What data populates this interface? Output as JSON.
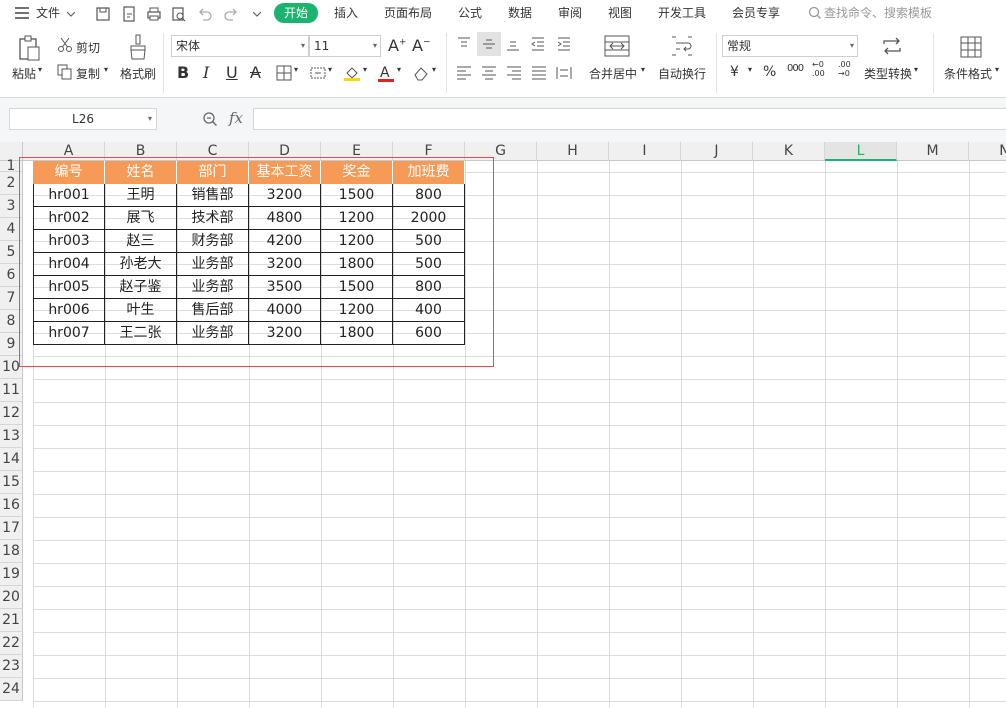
{
  "menubar": {
    "file": "文件",
    "tabs": [
      "开始",
      "插入",
      "页面布局",
      "公式",
      "数据",
      "审阅",
      "视图",
      "开发工具",
      "会员专享"
    ],
    "search_placeholder": "查找命令、搜索模板"
  },
  "ribbon": {
    "paste": "粘贴",
    "cut": "剪切",
    "copy": "复制",
    "format_painter": "格式刷",
    "font_name": "宋体",
    "font_size": "11",
    "merge_center": "合并居中",
    "wrap_text": "自动换行",
    "number_format": "常规",
    "type_convert": "类型转换",
    "cond_format": "条件格式",
    "currency_symbol": "¥",
    "percent_symbol": "%"
  },
  "formula_bar": {
    "name_box": "L26",
    "fx": "fx",
    "content": ""
  },
  "sheet": {
    "columns": [
      "A",
      "B",
      "C",
      "D",
      "E",
      "F",
      "G",
      "H",
      "I",
      "J",
      "K",
      "L",
      "M",
      "N"
    ],
    "active_column": "L",
    "rows": [
      "1",
      "2",
      "3",
      "4",
      "5",
      "6",
      "7",
      "8",
      "9",
      "10",
      "11",
      "12",
      "13",
      "14",
      "15",
      "16",
      "17",
      "18",
      "19",
      "20",
      "21",
      "22",
      "23",
      "24"
    ],
    "table_header": [
      "编号",
      "姓名",
      "部门",
      "基本工资",
      "奖金",
      "加班费"
    ],
    "table_rows": [
      [
        "hr001",
        "王明",
        "销售部",
        "3200",
        "1500",
        "800"
      ],
      [
        "hr002",
        "展飞",
        "技术部",
        "4800",
        "1200",
        "2000"
      ],
      [
        "hr003",
        "赵三",
        "财务部",
        "4200",
        "1200",
        "500"
      ],
      [
        "hr004",
        "孙老大",
        "业务部",
        "3200",
        "1800",
        "500"
      ],
      [
        "hr005",
        "赵子鉴",
        "业务部",
        "3500",
        "1500",
        "800"
      ],
      [
        "hr006",
        "叶生",
        "售后部",
        "4000",
        "1200",
        "400"
      ],
      [
        "hr007",
        "王二张",
        "业务部",
        "3200",
        "1800",
        "600"
      ]
    ]
  },
  "colors": {
    "accent": "#1bb36e",
    "table_header_bg": "#f59b57",
    "selection_border": "#e84c4c"
  }
}
